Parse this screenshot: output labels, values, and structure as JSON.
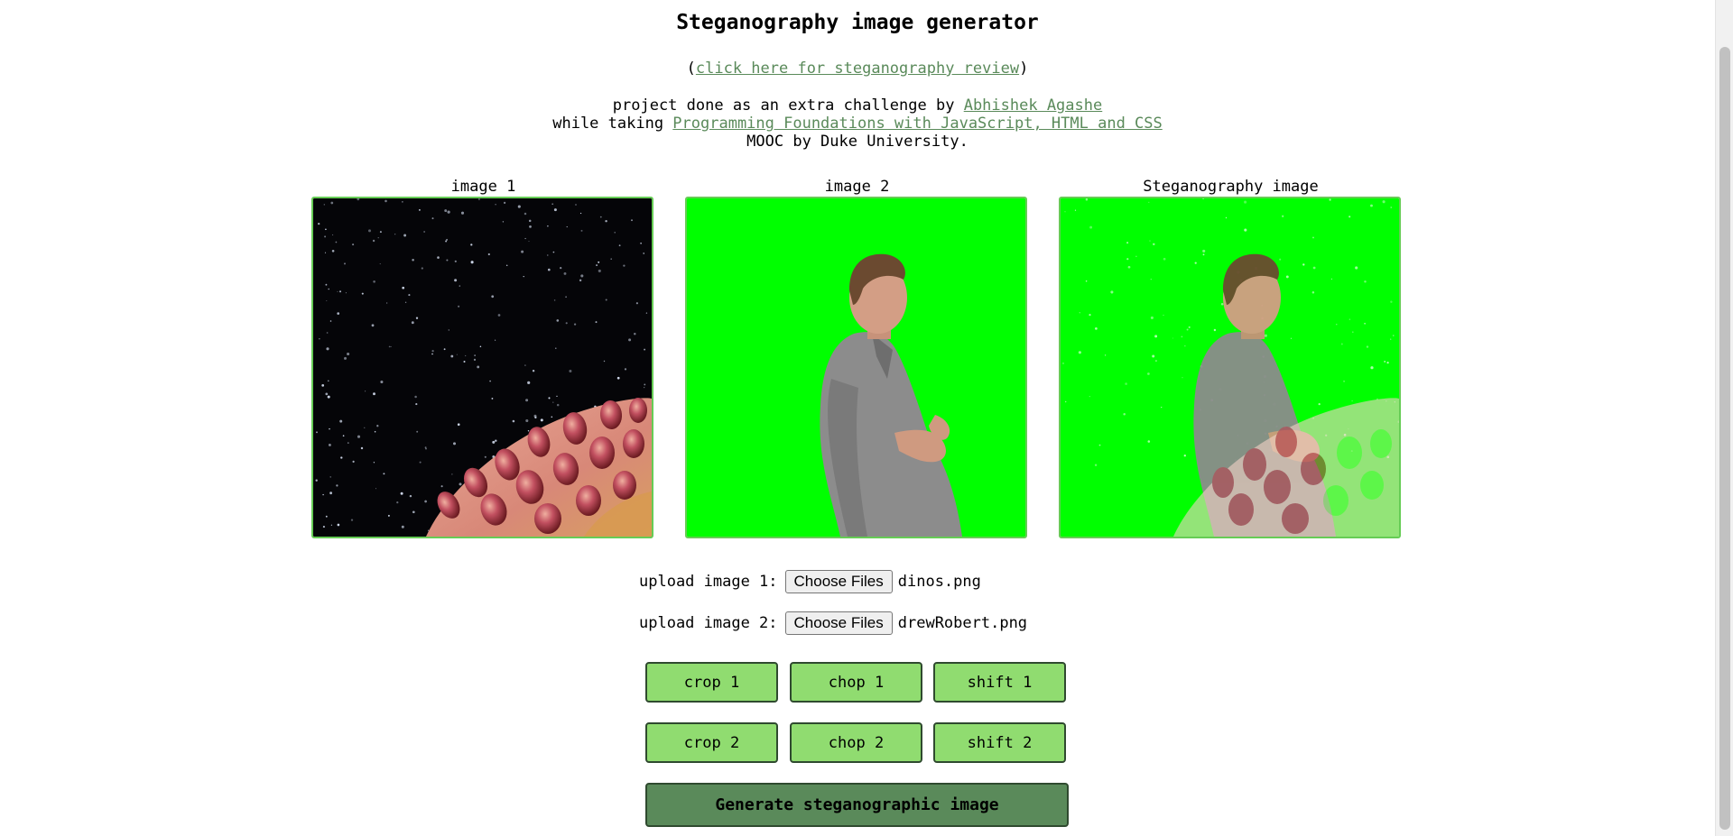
{
  "header": {
    "title": "Steganography image generator",
    "review_prefix": "(",
    "review_link": "click here for steganography review",
    "review_suffix": ")",
    "credit_line1_text": "project done as an extra challenge by ",
    "credit_author": "Abhishek Agashe",
    "credit_line2_text": "while taking ",
    "credit_course": "Programming Foundations with JavaScript, HTML and CSS",
    "credit_line3_text": "MOOC by Duke University."
  },
  "panels": [
    {
      "caption": "image 1"
    },
    {
      "caption": "image 2"
    },
    {
      "caption": "Steganography image"
    }
  ],
  "uploads": [
    {
      "label": "upload image 1:",
      "button": "Choose Files",
      "file": "dinos.png"
    },
    {
      "label": "upload image 2:",
      "button": "Choose Files",
      "file": "drewRobert.png"
    }
  ],
  "buttons": {
    "crop1": "crop 1",
    "chop1": "chop 1",
    "shift1": "shift 1",
    "crop2": "crop 2",
    "chop2": "chop 2",
    "shift2": "shift 2",
    "generate": "Generate steganographic image"
  },
  "colors": {
    "link": "#5a8a5a",
    "button": "#90dc70",
    "generate_button": "#5a8a5a",
    "green_screen": "#00ff00",
    "frame_border": "#66cc55"
  }
}
